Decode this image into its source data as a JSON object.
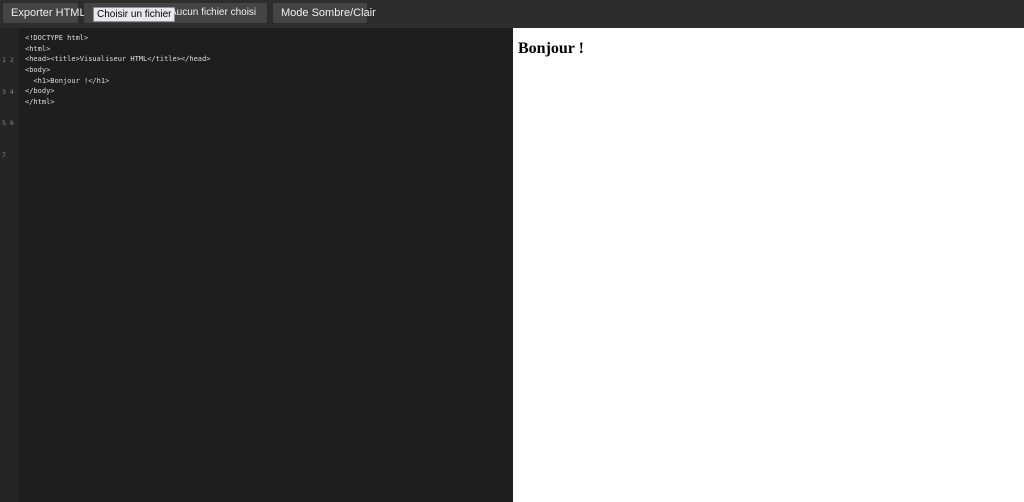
{
  "toolbar": {
    "export_label": "Exporter HTML",
    "file_button_label": "Choisir un fichier",
    "file_status": "Aucun fichier choisi",
    "theme_label": "Mode Sombre/Clair"
  },
  "editor": {
    "gutter_lines": [
      "1 2",
      "3 4",
      "5 6",
      "7"
    ],
    "lines": [
      "<!DOCTYPE html>",
      "<html>",
      "<head><title>Visualiseur HTML</title></head>",
      "<body>",
      "  <h1>Bonjour !</h1>",
      "</body>",
      "</html>"
    ]
  },
  "preview": {
    "heading": "Bonjour !"
  },
  "colors": {
    "toolbar_bg": "#2d2d2d",
    "button_bg": "#444444",
    "editor_bg": "#1e1e1e",
    "gutter_bg": "#252526",
    "preview_bg": "#ffffff"
  }
}
